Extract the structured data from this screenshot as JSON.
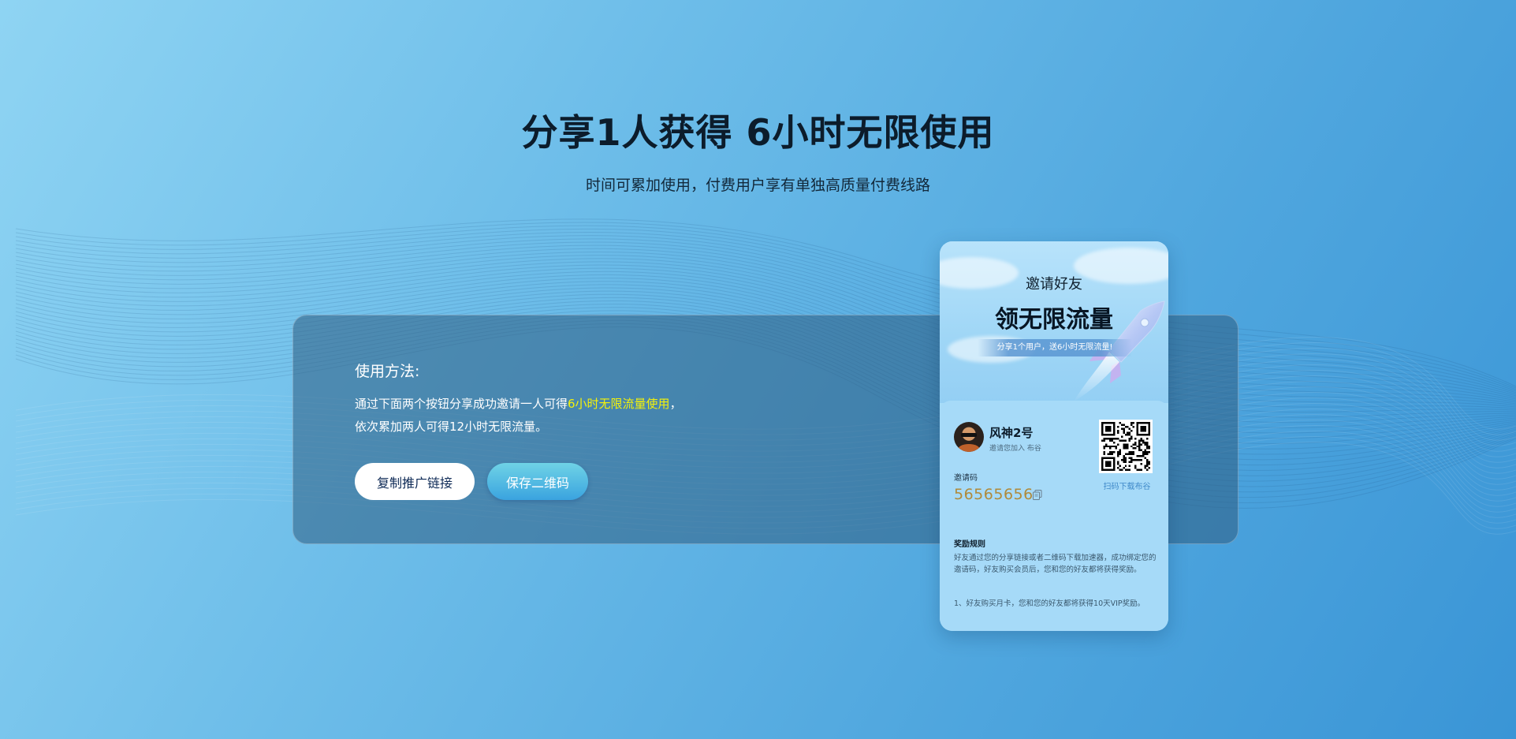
{
  "hero": {
    "title": "分享1人获得 6小时无限使用",
    "subtitle": "时间可累加使用，付费用户享有单独高质量付费线路"
  },
  "usage": {
    "title": "使用方法:",
    "line1_prefix": "通过下面两个按钮分享成功邀请一人可得",
    "line1_highlight": "6小时无限流量使用",
    "line1_suffix": "，",
    "line2": "依次累加两人可得12小时无限流量。"
  },
  "buttons": {
    "copy_link": "复制推广链接",
    "save_qr": "保存二维码"
  },
  "card": {
    "eyebrow": "邀请好友",
    "headline": "领无限流量",
    "ribbon": "分享1个用户，送6小时无限流量!",
    "user_name": "风神2号",
    "user_sub": "邀请您加入 布谷",
    "code_label": "邀请码",
    "code_value": "56565656",
    "qr_caption": "扫码下载布谷",
    "rules_title": "奖励规则",
    "rules_text": "好友通过您的分享链接或者二维码下载加速器，成功绑定您的邀请码，好友购买会员后，您和您的好友都将获得奖励。",
    "rules_item_1": "1、好友购买月卡，您和您的好友都将获得10天VIP奖励。"
  },
  "colors": {
    "highlight": "#f4f20a",
    "code": "#b08a3a",
    "qr_caption": "#3f89c9"
  },
  "icons": {
    "copy": "copy-icon",
    "rocket": "rocket-illustration",
    "qr": "qr-code"
  }
}
